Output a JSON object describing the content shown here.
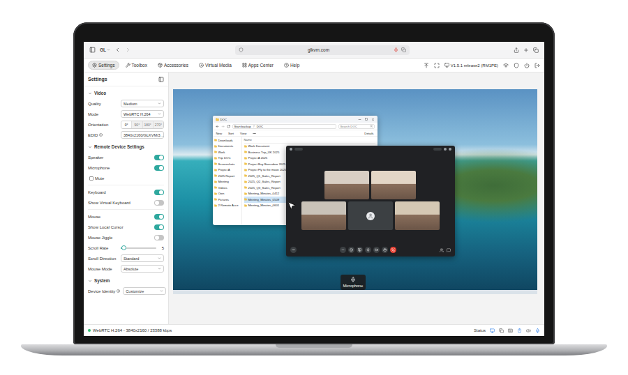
{
  "browser": {
    "profile": "GL",
    "url": "glkvm.com"
  },
  "toolbar": {
    "tabs": [
      {
        "label": "Settings",
        "selected": true
      },
      {
        "label": "Toolbox",
        "selected": false
      },
      {
        "label": "Accessories",
        "selected": false
      },
      {
        "label": "Virtual Media",
        "selected": false
      },
      {
        "label": "Apps Center",
        "selected": false
      },
      {
        "label": "Help",
        "selected": false
      }
    ],
    "version": "V1.5.1 release2 (RM1PE)"
  },
  "settings": {
    "title": "Settings",
    "sections": [
      {
        "title": "Video",
        "expanded": true,
        "groups": [
          [
            {
              "kind": "select",
              "label": "Quality",
              "value": "Medium",
              "info": false
            },
            {
              "kind": "select",
              "label": "Mode",
              "value": "WebRTC H.264",
              "info": false
            },
            {
              "kind": "segmented",
              "label": "Orientation",
              "options": [
                {
                  "label": "0°",
                  "selected": true
                },
                {
                  "label": "90°",
                  "selected": false
                },
                {
                  "label": "180°",
                  "selected": false
                },
                {
                  "label": "270°",
                  "selected": false
                }
              ]
            },
            {
              "kind": "select",
              "label": "EDID",
              "value": "3840x2160/GLKVM/3…",
              "info": true
            }
          ]
        ]
      },
      {
        "title": "Remote Device Settings",
        "expanded": true,
        "groups": [
          [
            {
              "kind": "toggle",
              "label": "Speaker",
              "on": true
            },
            {
              "kind": "toggle",
              "label": "Microphone",
              "on": true
            },
            {
              "kind": "checkbox",
              "label": "Mute",
              "checked": false
            }
          ],
          [
            {
              "kind": "toggle",
              "label": "Keyboard",
              "on": true
            },
            {
              "kind": "toggle",
              "label": "Show Virtual Keyboard",
              "on": false
            }
          ],
          [
            {
              "kind": "toggle",
              "label": "Mouse",
              "on": true
            },
            {
              "kind": "toggle",
              "label": "Show Local Cursor",
              "on": true
            },
            {
              "kind": "toggle",
              "label": "Mouse Jiggle",
              "on": false
            },
            {
              "kind": "slider",
              "label": "Scroll Rate",
              "level": 0.08,
              "value": "5"
            },
            {
              "kind": "select",
              "label": "Scroll Direction",
              "value": "Standard",
              "info": false
            },
            {
              "kind": "select",
              "label": "Mouse Mode",
              "value": "Absolute",
              "info": false
            }
          ]
        ]
      },
      {
        "title": "System",
        "expanded": true,
        "groups": [
          [
            {
              "kind": "select",
              "label": "Device Identity",
              "value": "Customize",
              "info": true
            }
          ]
        ]
      }
    ]
  },
  "desktop": {
    "explorer": {
      "title": "DOC",
      "path": [
        "Start backup",
        "DOC"
      ],
      "search_placeholder": "Search DOC",
      "commands": [
        "New",
        "Sort",
        "View",
        "Details"
      ],
      "sidebar": [
        "Downloads",
        "Documents",
        "Work",
        "Trip DOC",
        "Screenshots",
        "Project A",
        "2025 Report",
        "Meeting",
        "Videos",
        "Own",
        "Pictures",
        "2 Remote Acce"
      ],
      "column": "Name",
      "files": [
        {
          "name": "Work Document",
          "selected": false
        },
        {
          "name": "Business Trip_UK 2025",
          "selected": false
        },
        {
          "name": "Project A 2025",
          "selected": false
        },
        {
          "name": "Project Buy Barnsdoor 2025",
          "selected": false
        },
        {
          "name": "Project Fly to the moon 2025",
          "selected": false
        },
        {
          "name": "2025_Q1_Sales_Report",
          "selected": false
        },
        {
          "name": "2025_Q2_Sales_Report",
          "selected": false
        },
        {
          "name": "2025_Q3_Sales_Report",
          "selected": false
        },
        {
          "name": "Meeting_Minutes_0412",
          "selected": false
        },
        {
          "name": "Meeting_Minutes_0509",
          "selected": true
        },
        {
          "name": "Meeting_Minutes_0601",
          "selected": false
        }
      ]
    },
    "meeting": {
      "participants": [
        [
          {
            "kind": "video",
            "color": "#d9cfc4"
          },
          {
            "kind": "video",
            "color": "#e3d6c6"
          }
        ],
        [
          {
            "kind": "video",
            "color": "#c9c2b8"
          },
          {
            "kind": "avatar",
            "color": "#3c4043"
          },
          {
            "kind": "video",
            "color": "#d5c8b4"
          }
        ]
      ]
    },
    "tooltip": {
      "label": "Microphone"
    }
  },
  "status_bar": {
    "connected": true,
    "text": "WebRTC H.264 - 3840x2160 / 23388 kbps",
    "status_label": "Status"
  }
}
